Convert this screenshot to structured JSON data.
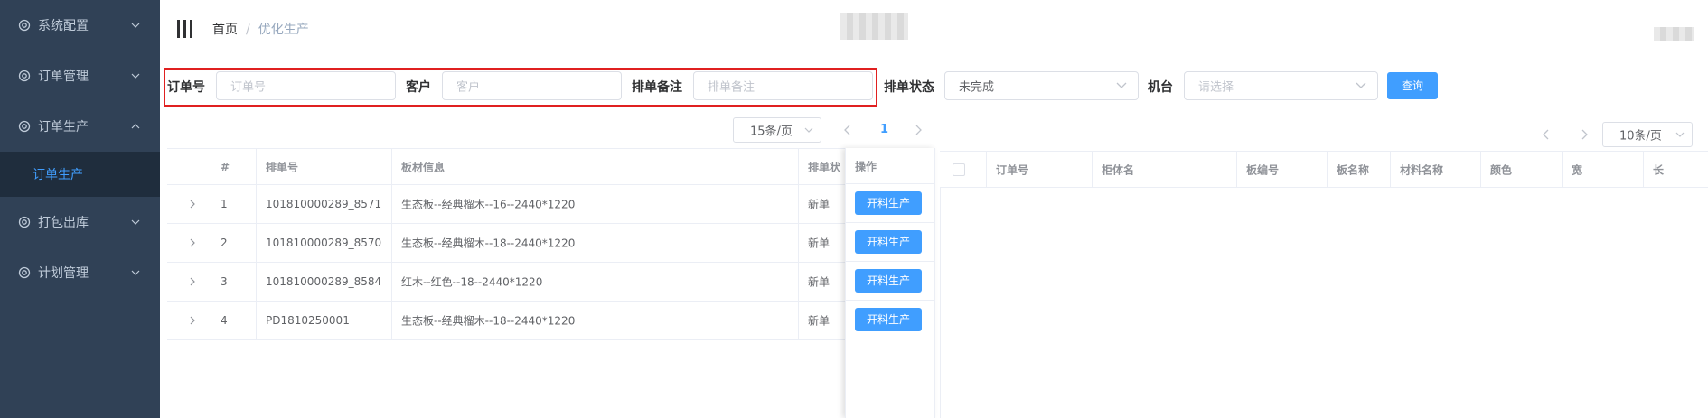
{
  "sidebar": {
    "items": [
      {
        "label": "系统配置",
        "icon": "gear-icon",
        "expanded": false
      },
      {
        "label": "订单管理",
        "icon": "gear-icon",
        "expanded": false
      },
      {
        "label": "订单生产",
        "icon": "gear-icon",
        "expanded": true
      },
      {
        "label": "打包出库",
        "icon": "gear-icon",
        "expanded": false
      },
      {
        "label": "计划管理",
        "icon": "gear-icon",
        "expanded": false
      }
    ],
    "submenu": {
      "label": "订单生产",
      "active_color": "#409eff"
    }
  },
  "header": {
    "breadcrumb": {
      "home": "首页",
      "separator": "/",
      "current": "优化生产"
    }
  },
  "search": {
    "order_no": {
      "label": "订单号",
      "placeholder": "订单号"
    },
    "customer": {
      "label": "客户",
      "placeholder": "客户"
    },
    "schedule_note": {
      "label": "排单备注",
      "placeholder": "排单备注"
    },
    "schedule_status": {
      "label": "排单状态",
      "value": "未完成"
    },
    "machine": {
      "label": "机台",
      "placeholder": "请选择"
    },
    "query_button": "查询"
  },
  "left_pagination": {
    "page_size": "15条/页",
    "current_page": "1"
  },
  "left_table": {
    "columns": [
      "#",
      "排单号",
      "板材信息",
      "排单状",
      "操作"
    ],
    "rows": [
      {
        "index": "1",
        "schedule_no": "101810000289_8571",
        "board_info": "生态板--经典榴木--16--2440*1220",
        "status": "新单",
        "action": "开料生产"
      },
      {
        "index": "2",
        "schedule_no": "101810000289_8570",
        "board_info": "生态板--经典榴木--18--2440*1220",
        "status": "新单",
        "action": "开料生产"
      },
      {
        "index": "3",
        "schedule_no": "101810000289_8584",
        "board_info": "红木--红色--18--2440*1220",
        "status": "新单",
        "action": "开料生产"
      },
      {
        "index": "4",
        "schedule_no": "PD1810250001",
        "board_info": "生态板--经典榴木--18--2440*1220",
        "status": "新单",
        "action": "开料生产"
      }
    ]
  },
  "right_pagination": {
    "page_size": "10条/页"
  },
  "right_table": {
    "columns": [
      "订单号",
      "柜体名",
      "板编号",
      "板名称",
      "材料名称",
      "颜色",
      "宽",
      "长"
    ]
  },
  "colors": {
    "sidebar_bg": "#304156",
    "accent": "#409eff",
    "highlight_box": "#e02020"
  }
}
